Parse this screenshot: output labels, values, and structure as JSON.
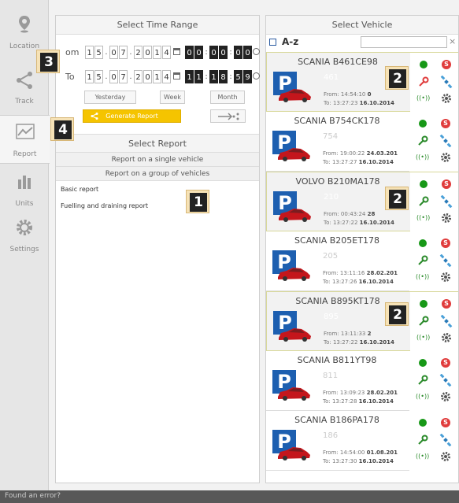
{
  "nav": [
    {
      "label": "Location",
      "icon": "location-pin-icon"
    },
    {
      "label": "Track",
      "icon": "share-track-icon"
    },
    {
      "label": "Report",
      "icon": "report-chart-icon"
    },
    {
      "label": "Units",
      "icon": "units-bars-icon"
    },
    {
      "label": "Settings",
      "icon": "gear-icon"
    }
  ],
  "time": {
    "header": "Select Time Range",
    "from_prefix": "om",
    "to_prefix": "To",
    "from_date": [
      "1",
      "5",
      "0",
      "7",
      "2",
      "0",
      "1",
      "4"
    ],
    "from_time": [
      "0",
      "0",
      "0",
      "0",
      "0",
      "0"
    ],
    "to_date": [
      "1",
      "5",
      "0",
      "7",
      "2",
      "0",
      "1",
      "4"
    ],
    "to_time": [
      "1",
      "1",
      "1",
      "8",
      "5",
      "9"
    ],
    "yesterday": "Yesterday",
    "week": "Week",
    "month": "Month",
    "generate": "Generate Report"
  },
  "report": {
    "header": "Select Report",
    "single": "Report on a single vehicle",
    "group": "Report on a group of vehicles",
    "items": [
      "Basic report",
      "Fuelling and draining report"
    ]
  },
  "vehicles": {
    "header": "Select Vehicle",
    "az": "A-z",
    "search_value": "",
    "clear": "×",
    "list": [
      {
        "name": "SCANIA B461CE98",
        "num": "461",
        "from": "From: 14:54:10",
        "from_date": "0",
        "to": "To: 13:27:23",
        "to_date": "16.10.2014",
        "selected": true
      },
      {
        "name": "SCANIA B754CK178",
        "num": "754",
        "from": "From: 19:00:22",
        "from_date": "24.03.201",
        "to": "To: 13:27:27",
        "to_date": "16.10.2014",
        "selected": false
      },
      {
        "name": "VOLVO B210MA178",
        "num": "210",
        "from": "From: 00:43:24",
        "from_date": "28",
        "to": "To: 13:27:22",
        "to_date": "16.10.2014",
        "selected": true
      },
      {
        "name": "SCANIA B205ET178",
        "num": "205",
        "from": "From: 13:11:16",
        "from_date": "28.02.201",
        "to": "To: 13:27:26",
        "to_date": "16.10.2014",
        "selected": false
      },
      {
        "name": "SCANIA B895KT178",
        "num": "895",
        "from": "From: 13:11:33",
        "from_date": "2",
        "to": "To: 13:27:22",
        "to_date": "16.10.2014",
        "selected": true
      },
      {
        "name": "SCANIA B811YT98",
        "num": "811",
        "from": "From: 13:09:23",
        "from_date": "28.02.201",
        "to": "To: 13:27:28",
        "to_date": "16.10.2014",
        "selected": false
      },
      {
        "name": "SCANIA B186PA178",
        "num": "186",
        "from": "From: 14:54:00",
        "from_date": "01.08.201",
        "to": "To: 13:27:30",
        "to_date": "16.10.2014",
        "selected": false
      }
    ]
  },
  "callouts": [
    "3",
    "4",
    "1",
    "2",
    "2",
    "2"
  ],
  "footer": "Found an error?",
  "colors": {
    "accent": "#f5c400",
    "parking": "#1d5fb0",
    "status_on": "#179817",
    "stop": "#e03c3c"
  }
}
